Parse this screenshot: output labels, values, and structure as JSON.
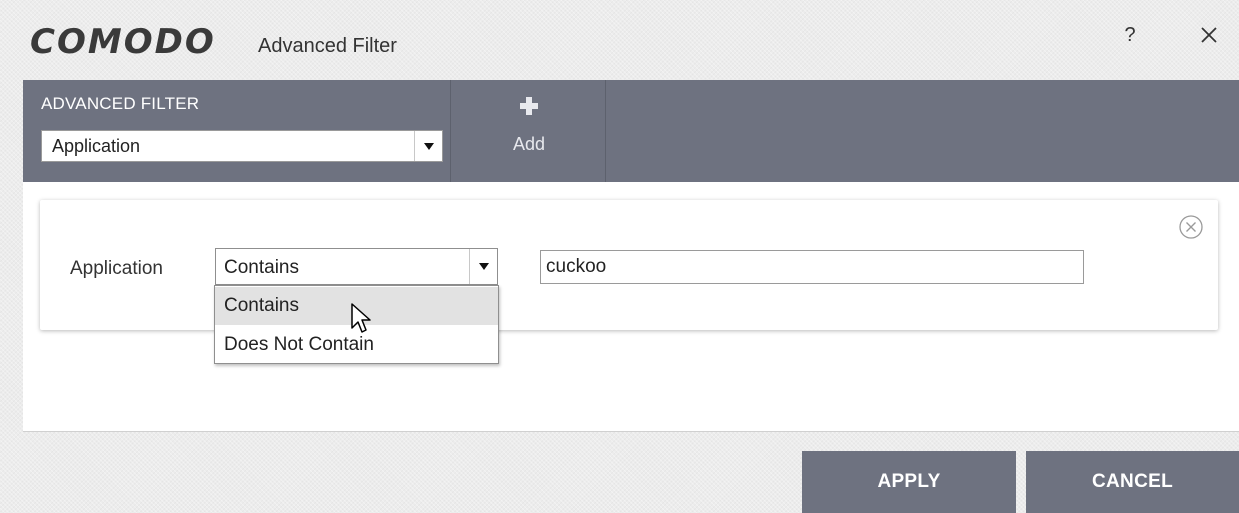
{
  "window": {
    "brand": "COMODO",
    "title": "Advanced Filter",
    "help_label": "?",
    "close_icon": "close-icon"
  },
  "toolbar": {
    "filter_label": "ADVANCED FILTER",
    "filter_select_value": "Application",
    "add_label": "Add",
    "add_icon": "plus-icon"
  },
  "rule": {
    "field_label": "Application",
    "condition_value": "Contains",
    "value_input": "cuckoo",
    "remove_icon": "remove-circle-icon"
  },
  "condition_dropdown": {
    "options": [
      "Contains",
      "Does Not Contain"
    ],
    "hovered_index": 0
  },
  "actions": {
    "apply_label": "APPLY",
    "cancel_label": "CANCEL"
  },
  "colors": {
    "toolbar_bg": "#6e7280",
    "button_bg": "#6e7280",
    "text_on_dark": "#ffffff"
  }
}
